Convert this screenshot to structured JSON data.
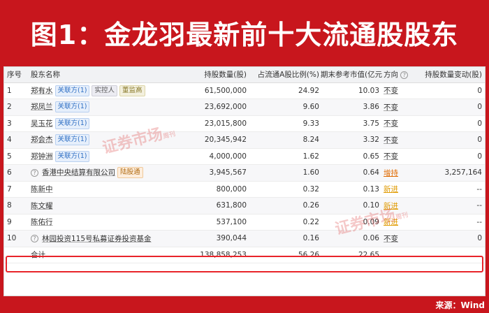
{
  "title": "图1：金龙羽最新前十大流通股股东",
  "source": "来源：Wind",
  "watermark": "证券市场",
  "watermark_small": "周刊",
  "headers": {
    "no": "序号",
    "name": "股东名称",
    "qty": "持股数量(股)",
    "ratio": "占流通A股比例(%)",
    "value": "期末参考市值(亿元)",
    "direction": "方向",
    "change": "持股数量变动(股)"
  },
  "rows": [
    {
      "no": "1",
      "name": "郑有水",
      "tags": [
        "关联方(1)",
        "实控人",
        "董监高"
      ],
      "qty": "61,500,000",
      "ratio": "24.92",
      "value": "10.03",
      "direction": "不变",
      "change": "0"
    },
    {
      "no": "2",
      "name": "郑凤兰",
      "tags": [
        "关联方(1)"
      ],
      "qty": "23,692,000",
      "ratio": "9.60",
      "value": "3.86",
      "direction": "不变",
      "change": "0"
    },
    {
      "no": "3",
      "name": "吴玉花",
      "tags": [
        "关联方(1)"
      ],
      "qty": "23,015,800",
      "ratio": "9.33",
      "value": "3.75",
      "direction": "不变",
      "change": "0"
    },
    {
      "no": "4",
      "name": "郑会杰",
      "tags": [
        "关联方(1)"
      ],
      "qty": "20,345,942",
      "ratio": "8.24",
      "value": "3.32",
      "direction": "不变",
      "change": "0"
    },
    {
      "no": "5",
      "name": "郑钟洲",
      "tags": [
        "关联方(1)"
      ],
      "qty": "4,000,000",
      "ratio": "1.62",
      "value": "0.65",
      "direction": "不变",
      "change": "0"
    },
    {
      "no": "6",
      "name": "香港中央结算有限公司",
      "tags": [
        "陆股通"
      ],
      "qty": "3,945,567",
      "ratio": "1.60",
      "value": "0.64",
      "direction": "增持",
      "change": "3,257,164"
    },
    {
      "no": "7",
      "name": "陈新中",
      "tags": [],
      "qty": "800,000",
      "ratio": "0.32",
      "value": "0.13",
      "direction": "新进",
      "change": "--"
    },
    {
      "no": "8",
      "name": "陈文耀",
      "tags": [],
      "qty": "631,800",
      "ratio": "0.26",
      "value": "0.10",
      "direction": "新进",
      "change": "--"
    },
    {
      "no": "9",
      "name": "陈佑行",
      "tags": [],
      "qty": "537,100",
      "ratio": "0.22",
      "value": "0.09",
      "direction": "新进",
      "change": "--"
    },
    {
      "no": "10",
      "name": "林园投资115号私募证券投资基金",
      "tags": [],
      "qty": "390,044",
      "ratio": "0.16",
      "value": "0.06",
      "direction": "不变",
      "change": "0"
    }
  ],
  "total": {
    "label": "合计",
    "qty": "138,858,253",
    "ratio": "56.26",
    "value": "22.65"
  },
  "help_glyph": "?",
  "colors": {
    "brand_red": "#c8161d",
    "highlight": "#e8242a",
    "increase": "#e06a00",
    "new": "#e09a00"
  }
}
